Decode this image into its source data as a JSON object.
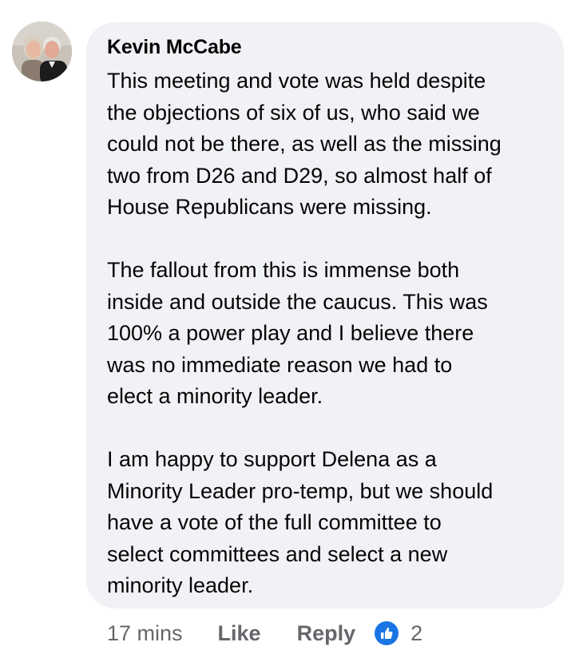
{
  "comment": {
    "author": "Kevin McCabe",
    "avatar_icon": "profile-photo-couple",
    "paragraphs": [
      [
        "This meeting and vote was held despite",
        "the objections of six of us, who said we",
        "could not be there, as well as the missing",
        "two from D26 and D29, so almost half of",
        "House Republicans were missing."
      ],
      [
        "The fallout from this is immense both",
        "inside and outside the caucus. This was",
        "100% a power play and I believe there",
        "was no immediate reason we had to",
        "elect a minority leader."
      ],
      [
        "I am happy to support Delena as a",
        "Minority Leader pro-temp, but we should",
        "have a vote of the full committee to",
        "select committees and select a new",
        "minority leader."
      ]
    ],
    "timestamp": "17 mins",
    "like_label": "Like",
    "reply_label": "Reply",
    "reaction_icon": "like-thumb-icon",
    "reaction_count": "2"
  },
  "colors": {
    "bubble_bg": "#f0f2f5",
    "meta_text": "#65676b",
    "reaction_blue": "#1b74e4"
  }
}
